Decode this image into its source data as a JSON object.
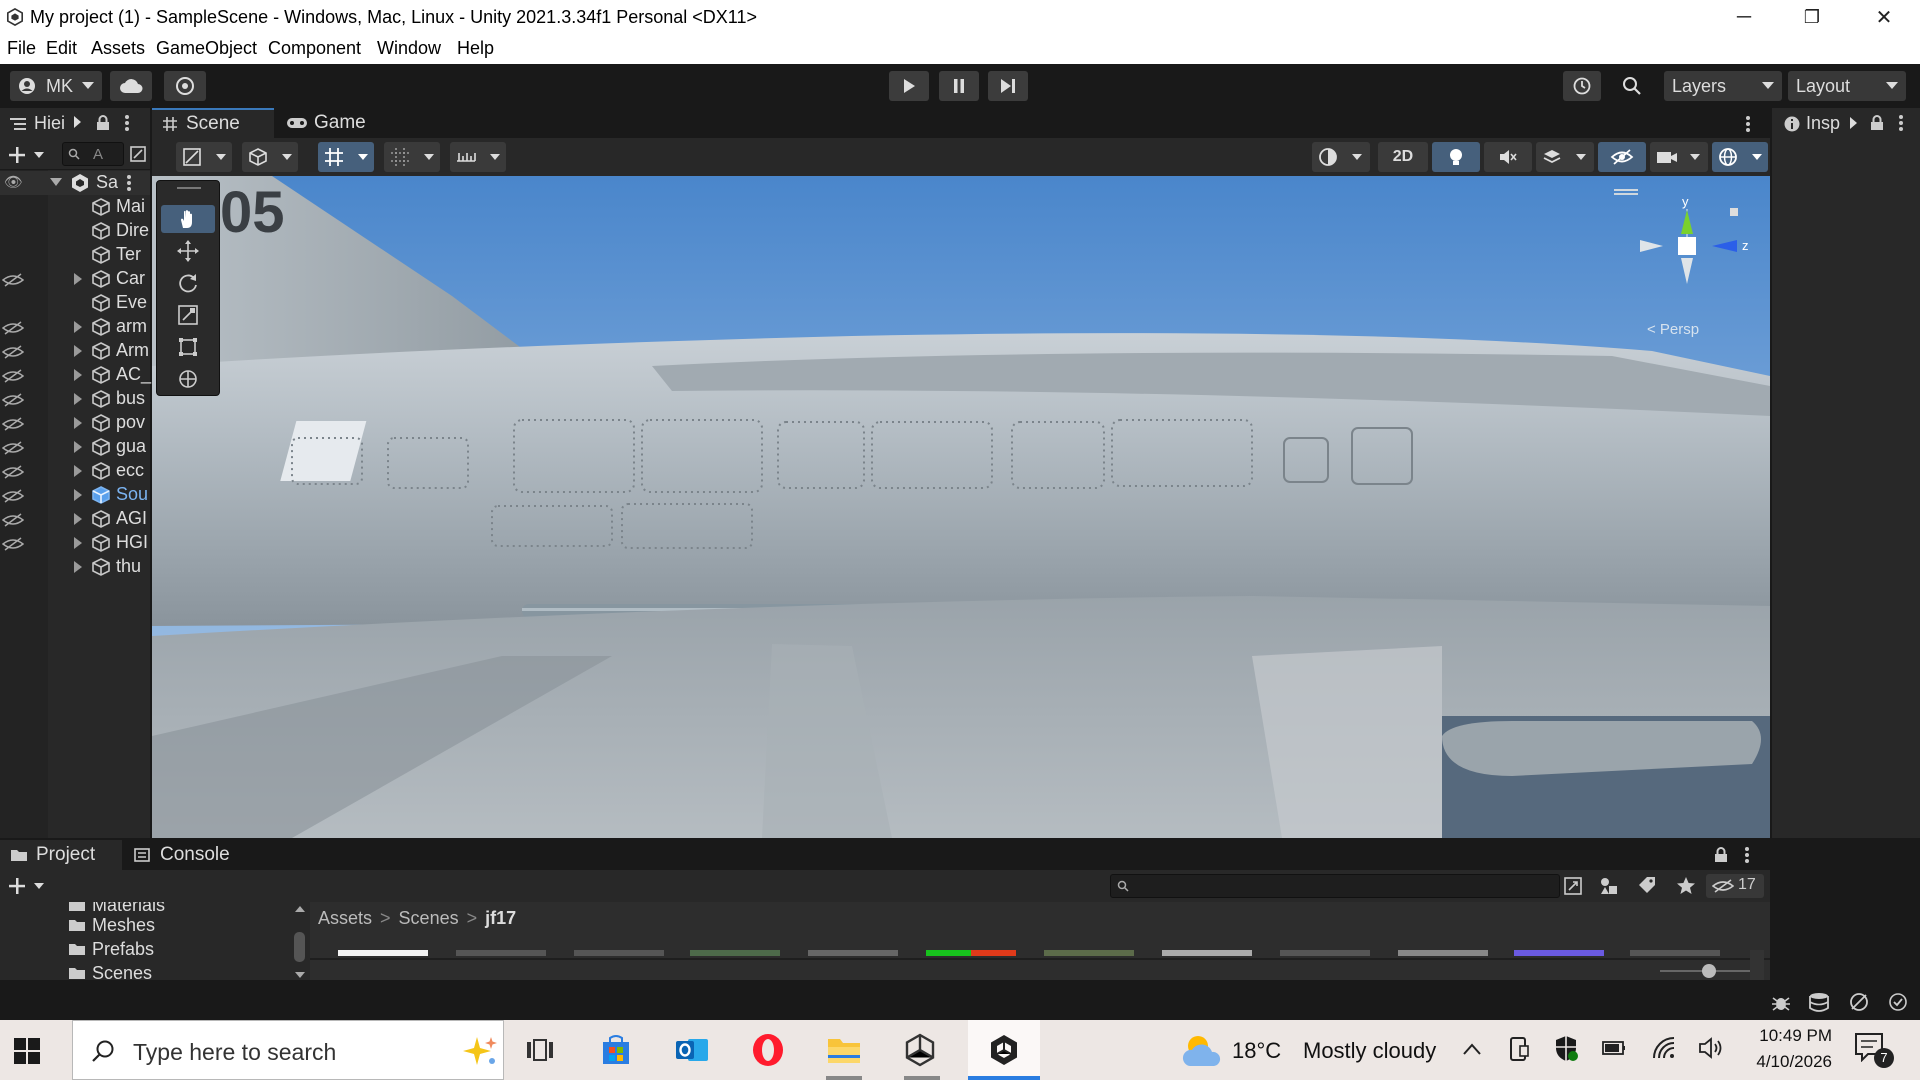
{
  "window": {
    "title": "My project (1) - SampleScene - Windows, Mac, Linux - Unity 2021.3.34f1 Personal <DX11>",
    "minimize": "─",
    "restore": "❐",
    "close": "✕"
  },
  "menu": [
    "File",
    "Edit",
    "Assets",
    "GameObject",
    "Component",
    "Window",
    "Help"
  ],
  "toolbar": {
    "account_label": "MK",
    "layers_label": "Layers",
    "layout_label": "Layout"
  },
  "hierarchy": {
    "tab_label": "Hiei",
    "search_placeholder": "A",
    "scene_label": "Sa",
    "items": [
      {
        "label": "Mai",
        "expandable": false,
        "hidden": false
      },
      {
        "label": "Dire",
        "expandable": false,
        "hidden": false
      },
      {
        "label": "Ter",
        "expandable": false,
        "hidden": false
      },
      {
        "label": "Car",
        "expandable": true,
        "hidden": true
      },
      {
        "label": "Eve",
        "expandable": false,
        "hidden": false
      },
      {
        "label": "arm",
        "expandable": true,
        "hidden": true
      },
      {
        "label": "Arm",
        "expandable": true,
        "hidden": true
      },
      {
        "label": "AC_",
        "expandable": true,
        "hidden": true
      },
      {
        "label": "bus",
        "expandable": true,
        "hidden": true
      },
      {
        "label": "pov",
        "expandable": true,
        "hidden": true
      },
      {
        "label": "gua",
        "expandable": true,
        "hidden": true
      },
      {
        "label": "ecc",
        "expandable": true,
        "hidden": true
      },
      {
        "label": "Sou",
        "expandable": true,
        "hidden": true,
        "prefab": true
      },
      {
        "label": "AGI",
        "expandable": true,
        "hidden": true
      },
      {
        "label": "HGI",
        "expandable": true,
        "hidden": true
      },
      {
        "label": "thu",
        "expandable": true,
        "hidden": false
      }
    ]
  },
  "scene_tabs": {
    "scene_label": "Scene",
    "game_label": "Game"
  },
  "scene_toolbar": {
    "mode_2d_label": "2D"
  },
  "viewport": {
    "aircraft_number": "05",
    "gizmo_y": "y",
    "gizmo_z": "z",
    "persp_label": "< Persp"
  },
  "inspector": {
    "tab_label": "Insp"
  },
  "project": {
    "project_tab": "Project",
    "console_tab": "Console",
    "folders": [
      "Materials",
      "Meshes",
      "Prefabs",
      "Scenes"
    ],
    "breadcrumb": [
      "Assets",
      "Scenes",
      "jf17"
    ],
    "hidden_count": "17"
  },
  "taskbar": {
    "search_placeholder": "Type here to search",
    "weather_temp": "18°C",
    "weather_desc": "Mostly cloudy",
    "time": "10:49 PM",
    "date": "4/10/2026",
    "notification_count": "7"
  },
  "colors": {
    "accent": "#46607c",
    "sky_top": "#4d88cc",
    "sky_bottom": "#a8c6e4",
    "metal": "#aeb6bd",
    "unity_dark": "#191919",
    "panel": "#282828"
  }
}
